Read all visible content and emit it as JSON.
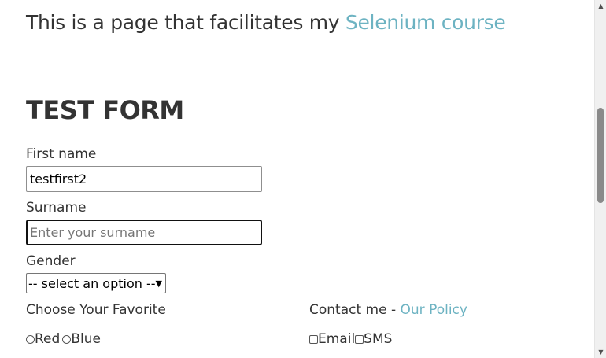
{
  "intro": {
    "text": "This is a page that facilitates my ",
    "link_text": "Selenium course"
  },
  "form": {
    "title": "TEST FORM",
    "first_name": {
      "label": "First name",
      "value": "testfirst2"
    },
    "surname": {
      "label": "Surname",
      "value": "",
      "placeholder": "Enter your surname"
    },
    "gender": {
      "label": "Gender",
      "selected": "-- select an option --"
    },
    "favorite": {
      "label": "Choose Your Favorite",
      "options": [
        "Red",
        "Blue"
      ]
    },
    "contact": {
      "label": "Contact me - ",
      "policy_link": "Our Policy",
      "options": [
        "Email",
        "SMS"
      ]
    }
  }
}
